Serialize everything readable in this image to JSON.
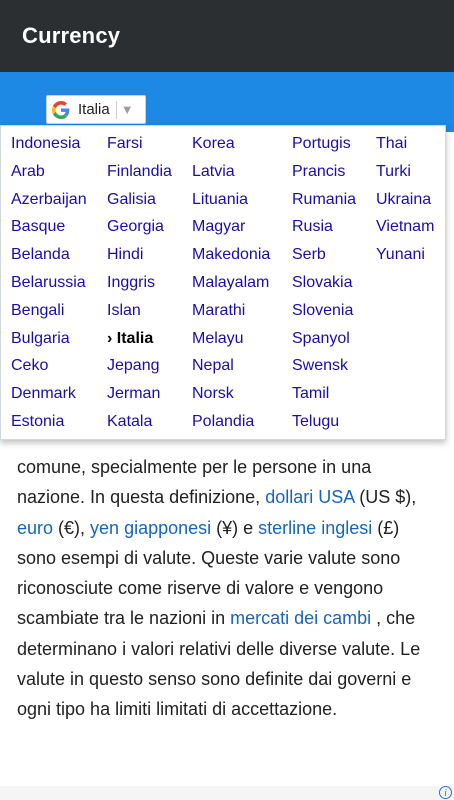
{
  "app": {
    "title": "Currency"
  },
  "translate": {
    "selected_language": "Italia",
    "arrow": "▼"
  },
  "menu": {
    "columns": [
      [
        "Indonesia",
        "Arab",
        "Azerbaijan",
        "Basque",
        "Belanda",
        "Belarussia",
        "Bengali",
        "Bulgaria",
        "Ceko",
        "Denmark",
        "Estonia"
      ],
      [
        "Farsi",
        "Finlandia",
        "Galisia",
        "Georgia",
        "Hindi",
        "Inggris",
        "Islan",
        "› Italia",
        "Jepang",
        "Jerman",
        "Katala"
      ],
      [
        "Korea",
        "Latvia",
        "Lituania",
        "Magyar",
        "Makedonia",
        "Malayalam",
        "Marathi",
        "Melayu",
        "Nepal",
        "Norsk",
        "Polandia"
      ],
      [
        "Portugis",
        "Prancis",
        "Rumania",
        "Rusia",
        "Serb",
        "Slovakia",
        "Slovenia",
        "Spanyol",
        "Swensk",
        "Tamil",
        "Telugu"
      ],
      [
        "Thai",
        "Turki",
        "Ukraina",
        "Vietnam",
        "Yunani"
      ]
    ]
  },
  "article": {
    "t1": "comune, specialmente per le persone in una nazione.  In questa definizione, ",
    "l1": "dollari USA",
    "t2": " (US $), ",
    "l2": "euro",
    "t3": " (€), ",
    "l3": "yen giapponesi",
    "t4": " (¥) e ",
    "l4": "sterline inglesi",
    "t5": " (£) sono esempi di valute. Queste varie valute sono riconosciute come riserve di valore e vengono scambiate tra le nazioni in ",
    "l5": "mercati dei cambi",
    "t6": " , che determinano i valori relativi delle diverse valute.  Le valute in questo senso sono definite dai governi e ogni tipo ha limiti limitati di accettazione."
  },
  "colors": {
    "appbar": "#2c2f31",
    "band": "#1e88e5",
    "menu_link": "#1a0dab",
    "article_link": "#1565c0"
  },
  "icons": {
    "google": "google-g-icon",
    "dropdown": "dropdown-arrow-icon",
    "ad": "ad-info-icon"
  }
}
